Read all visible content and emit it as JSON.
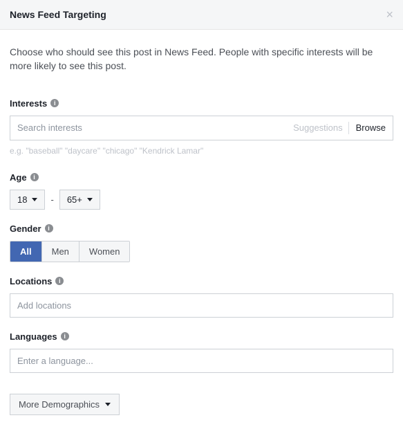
{
  "header": {
    "title": "News Feed Targeting"
  },
  "description": "Choose who should see this post in News Feed. People with specific interests will be more likely to see this post.",
  "interests": {
    "label": "Interests",
    "placeholder": "Search interests",
    "suggestions": "Suggestions",
    "browse": "Browse",
    "hint": "e.g. \"baseball\" \"daycare\" \"chicago\" \"Kendrick Lamar\""
  },
  "age": {
    "label": "Age",
    "min": "18",
    "max": "65+"
  },
  "gender": {
    "label": "Gender",
    "options": [
      "All",
      "Men",
      "Women"
    ],
    "selected": "All"
  },
  "locations": {
    "label": "Locations",
    "placeholder": "Add locations"
  },
  "languages": {
    "label": "Languages",
    "placeholder": "Enter a language..."
  },
  "more_demographics": "More Demographics"
}
